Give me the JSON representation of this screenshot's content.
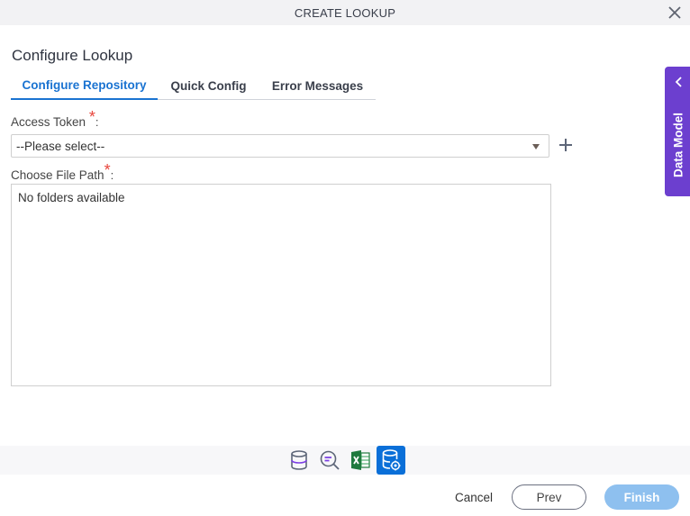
{
  "window": {
    "title": "CREATE LOOKUP",
    "close_icon": "close-icon"
  },
  "section": {
    "title": "Configure Lookup"
  },
  "tabs": [
    {
      "label": "Configure Repository",
      "active": true
    },
    {
      "label": "Quick Config",
      "active": false
    },
    {
      "label": "Error Messages",
      "active": false
    }
  ],
  "form": {
    "access_token": {
      "label": "Access Token",
      "required_mark": "*",
      "colon": ":",
      "selected_value": "--Please select--",
      "add_icon": "plus-icon"
    },
    "file_path": {
      "label": "Choose File Path",
      "required_mark": "*",
      "colon": ":",
      "empty_text": "No folders available"
    }
  },
  "side_panel": {
    "label": "Data Model",
    "icon": "chevron-left-icon",
    "color": "#6c3fcf"
  },
  "icon_bar": [
    {
      "name": "database-icon",
      "active": false
    },
    {
      "name": "search-query-icon",
      "active": false
    },
    {
      "name": "excel-icon",
      "active": false
    },
    {
      "name": "database-settings-icon",
      "active": true
    }
  ],
  "footer": {
    "cancel_label": "Cancel",
    "prev_label": "Prev",
    "finish_label": "Finish"
  },
  "colors": {
    "accent": "#1a73d1",
    "required": "#e8453c",
    "finish_disabled": "#8ec0ef",
    "active_icon_bg": "#0a6fd8"
  }
}
